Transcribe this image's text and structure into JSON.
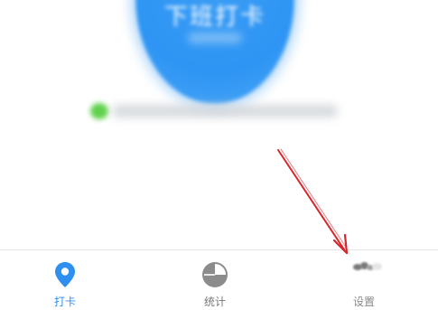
{
  "clock_button": {
    "label": "下班打卡",
    "color": "#2e95f4"
  },
  "location": {
    "indicator_color": "#5fd14a",
    "status_icon": "location-ok-dot"
  },
  "tabbar": {
    "items": [
      {
        "label": "打卡",
        "icon": "location-pin-icon",
        "active": true,
        "color": "#2e8ff0"
      },
      {
        "label": "统计",
        "icon": "pie-chart-icon",
        "active": false,
        "color": "#777777"
      },
      {
        "label": "设置",
        "icon": "gear-icon",
        "active": false,
        "color": "#8a8a8a"
      }
    ]
  },
  "annotation": {
    "type": "arrow",
    "color": "#d8262c",
    "points_to": "settings"
  }
}
